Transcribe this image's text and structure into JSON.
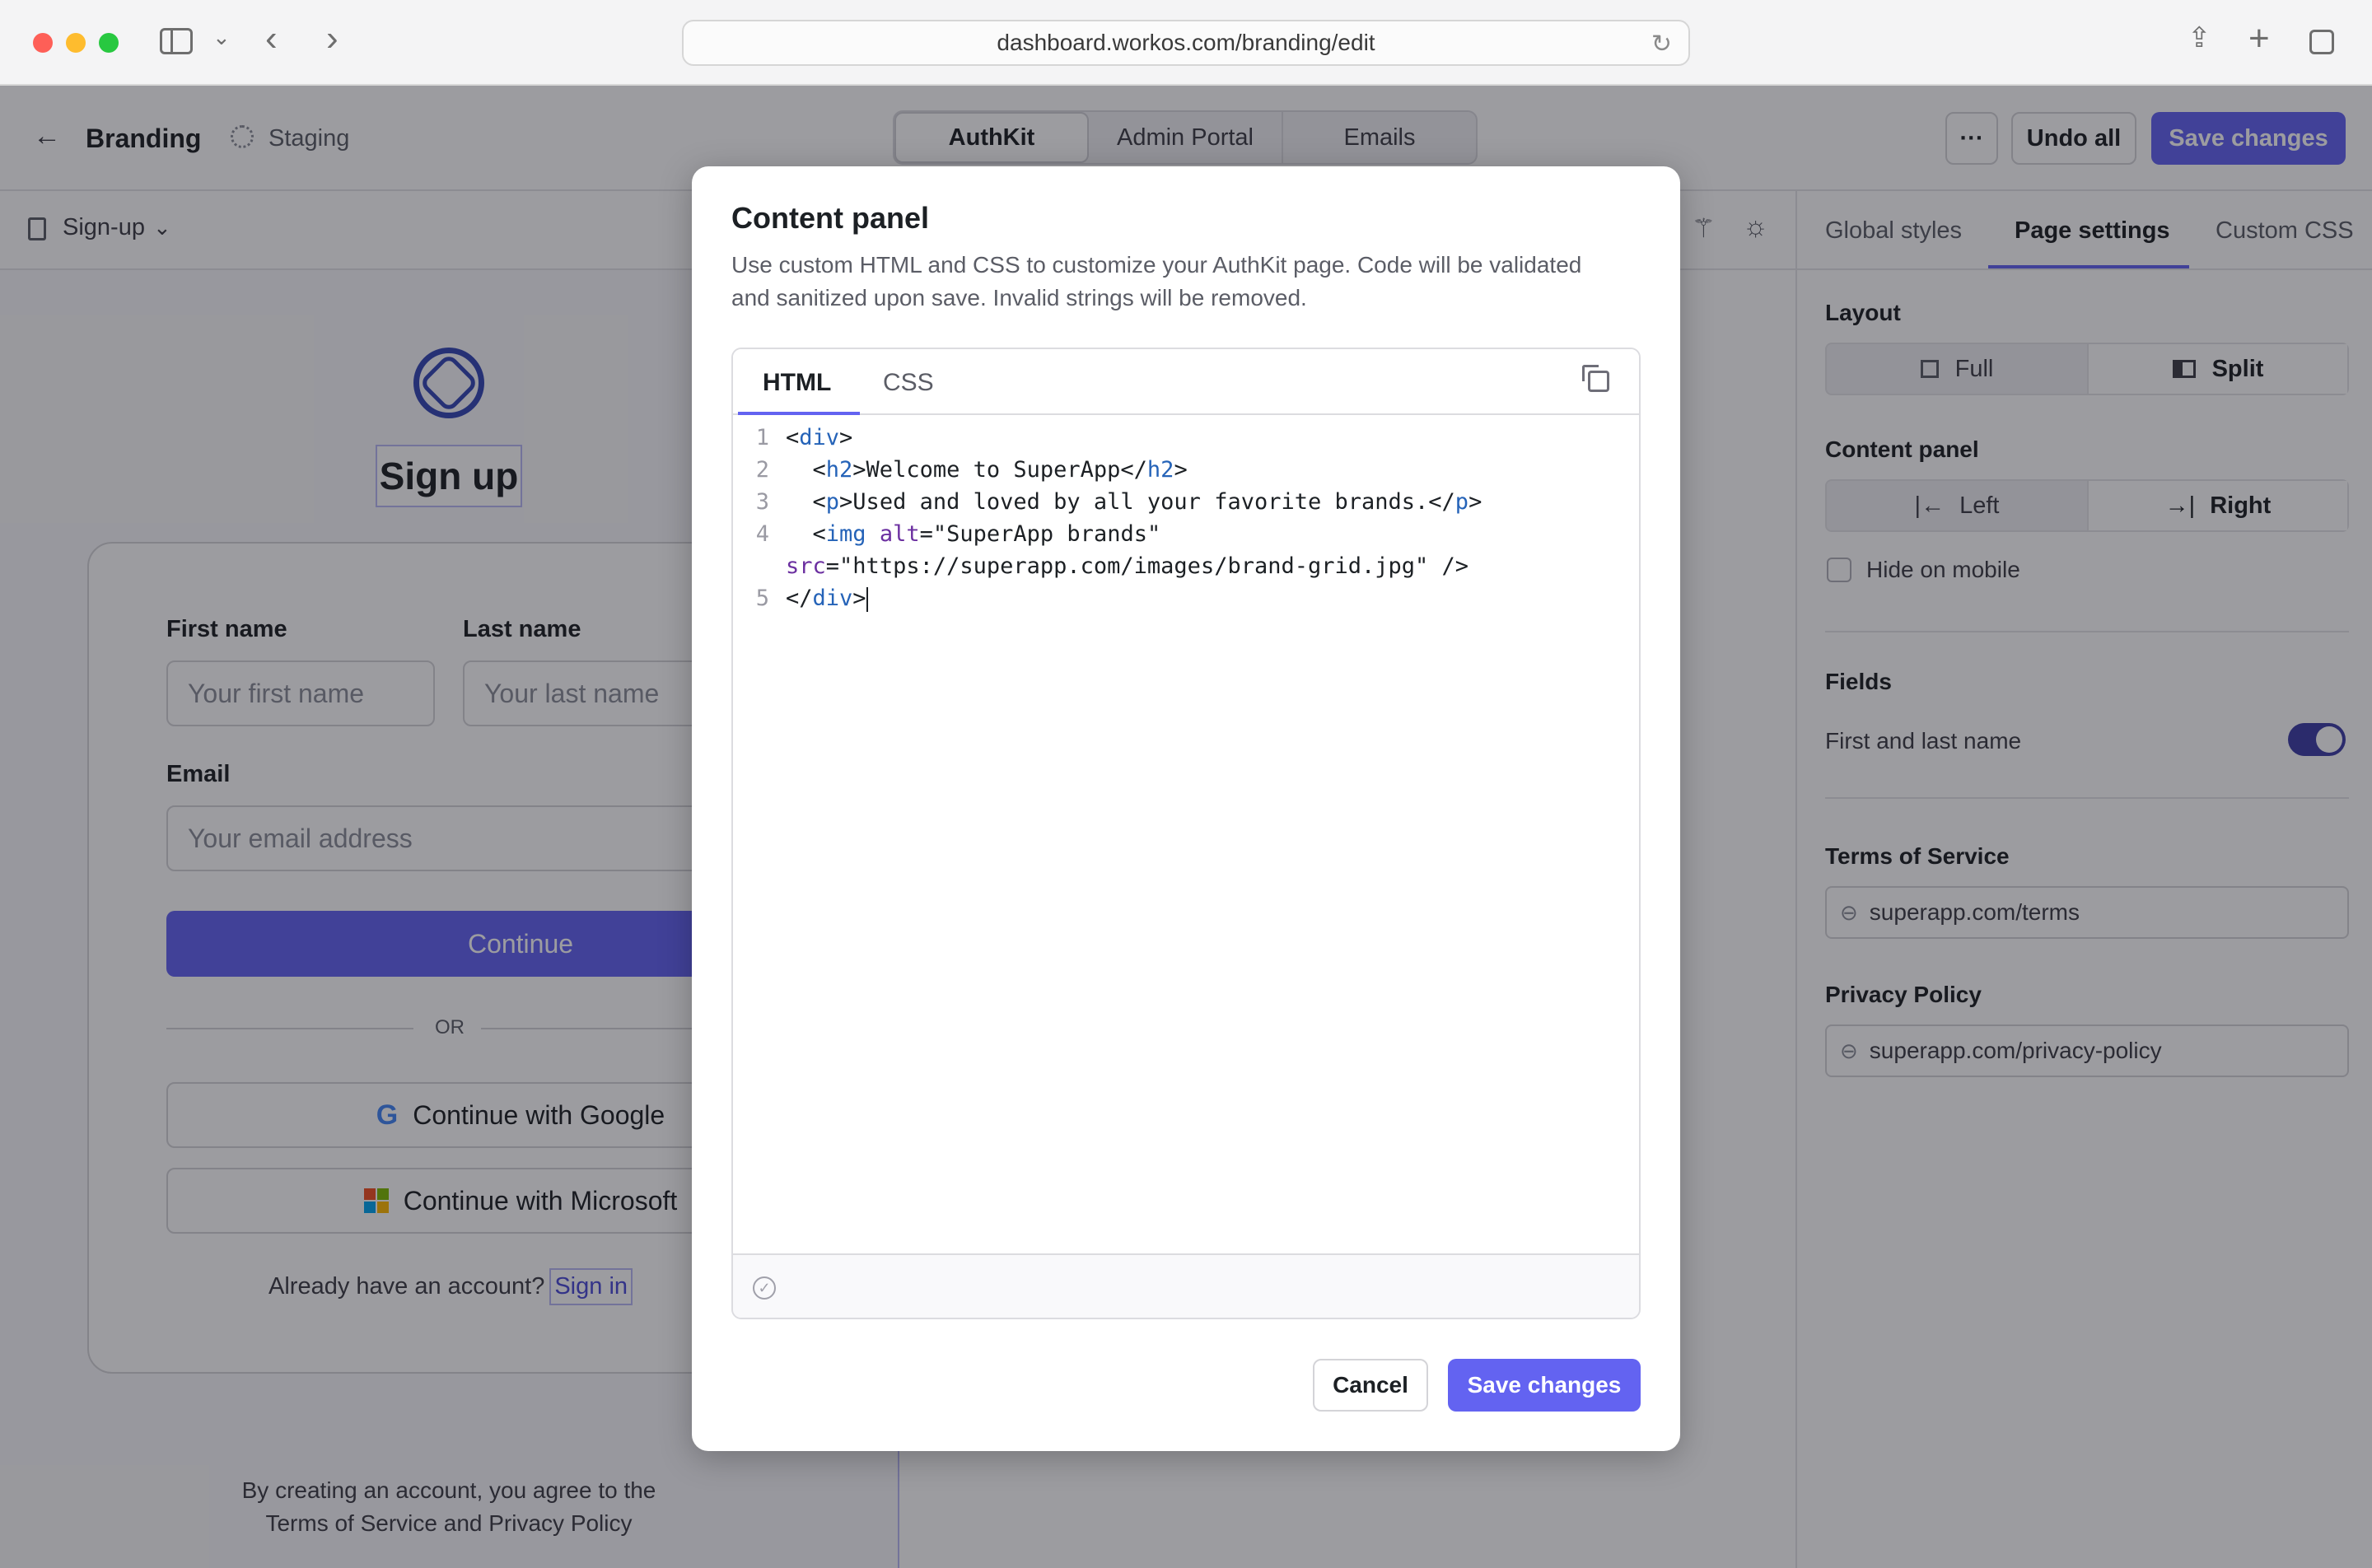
{
  "browser": {
    "url": "dashboard.workos.com/branding/edit"
  },
  "header": {
    "title": "Branding",
    "environment": "Staging",
    "tabs": [
      "AuthKit",
      "Admin Portal",
      "Emails"
    ],
    "active_tab": "AuthKit",
    "more_label": "···",
    "undo_label": "Undo all",
    "save_label": "Save changes"
  },
  "subbar": {
    "page_select": "Sign-up",
    "right_tabs": [
      "Global styles",
      "Page settings",
      "Custom CSS"
    ],
    "active_right_tab": "Page settings"
  },
  "preview": {
    "heading": "Sign up",
    "first_name_label": "First name",
    "first_name_placeholder": "Your first name",
    "last_name_label": "Last name",
    "last_name_placeholder": "Your last name",
    "email_label": "Email",
    "email_placeholder": "Your email address",
    "continue_label": "Continue",
    "or_label": "OR",
    "google_label": "Continue with Google",
    "microsoft_label": "Continue with Microsoft",
    "already_text": "Already have an account?",
    "sign_in_label": "Sign in",
    "terms_line1": "By creating an account, you agree to the",
    "terms_line2": "Terms of Service and Privacy Policy"
  },
  "settings": {
    "layout_label": "Layout",
    "layout_options": [
      "Full",
      "Split"
    ],
    "layout_selected": "Split",
    "content_panel_label": "Content panel",
    "content_panel_options": [
      "Left",
      "Right"
    ],
    "content_panel_selected": "Right",
    "hide_on_mobile_label": "Hide on mobile",
    "hide_on_mobile_checked": false,
    "fields_label": "Fields",
    "first_last_label": "First and last name",
    "first_last_enabled": true,
    "tos_label": "Terms of Service",
    "tos_value": "superapp.com/terms",
    "privacy_label": "Privacy Policy",
    "privacy_value": "superapp.com/privacy-policy"
  },
  "modal": {
    "title": "Content panel",
    "description_line1": "Use custom HTML and CSS to customize your AuthKit page. Code will be validated",
    "description_line2": "and sanitized upon save. Invalid strings will be removed.",
    "tabs": [
      "HTML",
      "CSS"
    ],
    "active_tab": "HTML",
    "code_lines": [
      {
        "n": "1",
        "tokens": [
          [
            "p",
            "<"
          ],
          [
            "t",
            "div"
          ],
          [
            "p",
            ">"
          ]
        ]
      },
      {
        "n": "2",
        "tokens": [
          [
            "p",
            "  <"
          ],
          [
            "t",
            "h2"
          ],
          [
            "p",
            ">Welcome to SuperApp</"
          ],
          [
            "t",
            "h2"
          ],
          [
            "p",
            ">"
          ]
        ]
      },
      {
        "n": "3",
        "tokens": [
          [
            "p",
            "  <"
          ],
          [
            "t",
            "p"
          ],
          [
            "p",
            ">Used and loved by all your favorite brands.</"
          ],
          [
            "t",
            "p"
          ],
          [
            "p",
            ">"
          ]
        ]
      },
      {
        "n": "4",
        "tokens": [
          [
            "p",
            "  <"
          ],
          [
            "t",
            "img"
          ],
          [
            "p",
            " "
          ],
          [
            "a",
            "alt"
          ],
          [
            "p",
            "="
          ],
          [
            "s",
            "\"SuperApp brands\""
          ]
        ]
      },
      {
        "n": "",
        "tokens": [
          [
            "a",
            "src"
          ],
          [
            "p",
            "="
          ],
          [
            "s",
            "\"https://superapp.com/images/brand-grid.jpg\""
          ],
          [
            "p",
            " />"
          ]
        ]
      },
      {
        "n": "5",
        "tokens": [
          [
            "p",
            "</"
          ],
          [
            "t",
            "div"
          ],
          [
            "p",
            ">"
          ]
        ]
      }
    ],
    "cancel_label": "Cancel",
    "save_label": "Save changes"
  },
  "colors": {
    "accent": "#6363f1",
    "overlay": "rgba(20,20,28,0.42)"
  }
}
